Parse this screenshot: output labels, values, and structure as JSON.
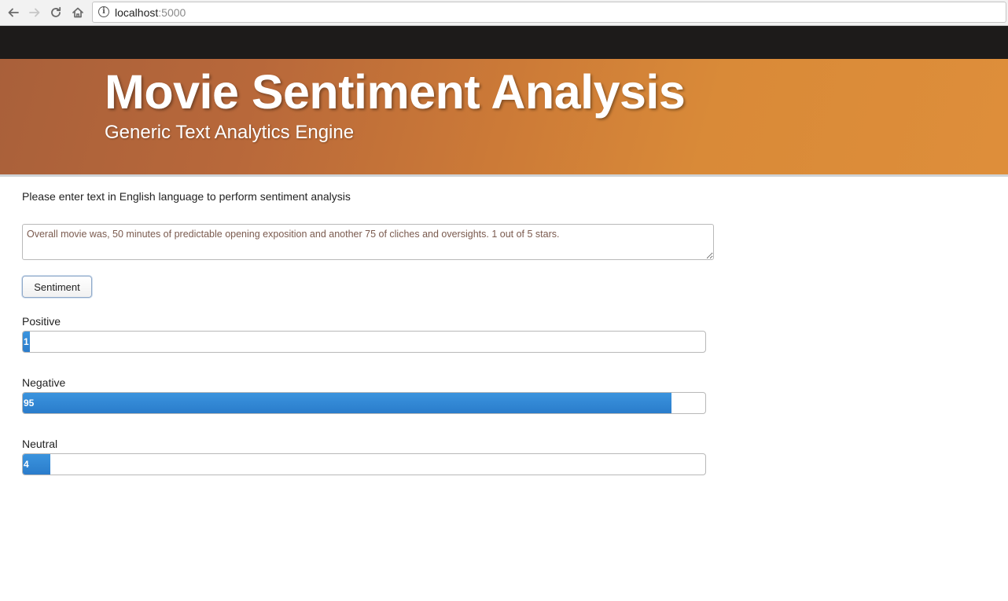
{
  "browser": {
    "url_host": "localhost",
    "url_port": ":5000"
  },
  "header": {
    "title": "Movie Sentiment Analysis",
    "subtitle": "Generic Text Analytics Engine"
  },
  "form": {
    "instructions": "Please enter text in English language to perform sentiment analysis",
    "review_text": "Overall movie was, 50 minutes of predictable opening exposition and another 75 of cliches and oversights. 1 out of 5 stars.",
    "submit_label": "Sentiment"
  },
  "results": {
    "positive": {
      "label": "Positive",
      "value": 1,
      "display": "1"
    },
    "negative": {
      "label": "Negative",
      "value": 95,
      "display": "95"
    },
    "neutral": {
      "label": "Neutral",
      "value": 4,
      "display": "4"
    }
  },
  "colors": {
    "bar_fill": "#2f86d2",
    "navbar": "#1d1b1a",
    "hero_start": "#a9603a",
    "hero_end": "#de8e3a"
  },
  "icons": {
    "back": "back-arrow-icon",
    "forward": "forward-arrow-icon",
    "reload": "reload-icon",
    "home": "home-icon",
    "info": "info-icon"
  }
}
